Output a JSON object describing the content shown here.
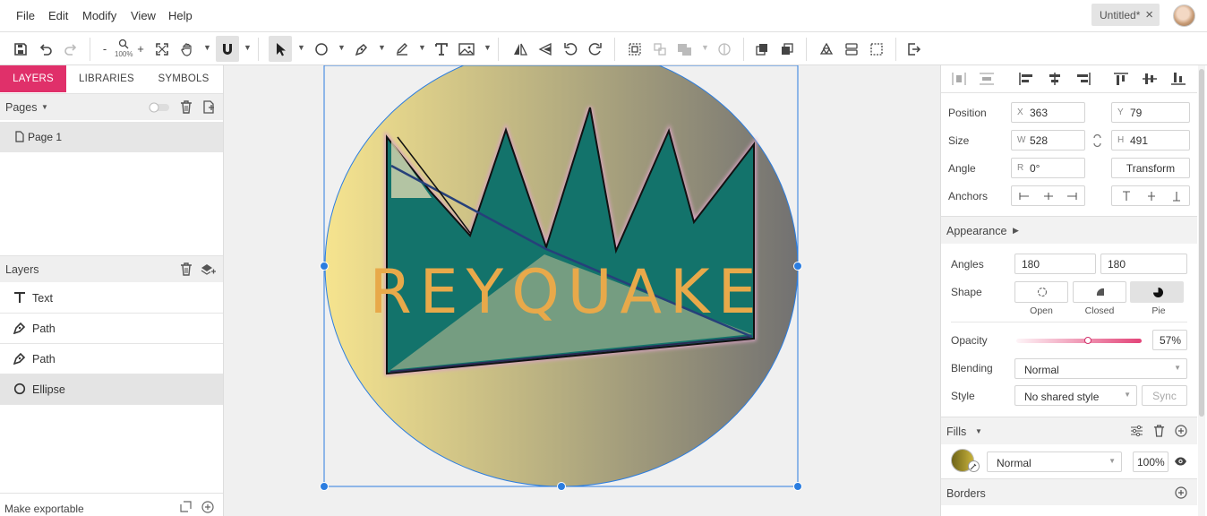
{
  "menu": {
    "file": "File",
    "edit": "Edit",
    "modify": "Modify",
    "view": "View",
    "help": "Help"
  },
  "document": {
    "title": "Untitled*"
  },
  "toolbar": {
    "zoom_level": "100%",
    "zoom_out": "-",
    "zoom_in": "+"
  },
  "left_panel": {
    "tabs": {
      "layers": "LAYERS",
      "libraries": "LIBRARIES",
      "symbols": "SYMBOLS"
    },
    "pages_header": "Pages",
    "pages": [
      {
        "name": "Page 1"
      }
    ],
    "layers_header": "Layers",
    "layers": [
      {
        "name": "Text",
        "icon": "text-icon"
      },
      {
        "name": "Path",
        "icon": "pen-icon"
      },
      {
        "name": "Path",
        "icon": "pen-icon"
      },
      {
        "name": "Ellipse",
        "icon": "ellipse-icon",
        "selected": true
      }
    ],
    "export_label": "Make exportable"
  },
  "canvas": {
    "logo_text": "REYQUAKE",
    "colors": {
      "teal": "#13736b",
      "gold": "#e8a94a",
      "gradient_start": "#f6e48f",
      "gradient_end": "#727171",
      "selection": "#2b7de0"
    }
  },
  "inspector": {
    "position": {
      "label": "Position",
      "x_prefix": "X",
      "x": "363",
      "y_prefix": "Y",
      "y": "79"
    },
    "size": {
      "label": "Size",
      "w_prefix": "W",
      "w": "528",
      "h_prefix": "H",
      "h": "491"
    },
    "angle": {
      "label": "Angle",
      "r_prefix": "R",
      "r": "0°",
      "transform_button": "Transform"
    },
    "anchors": {
      "label": "Anchors"
    },
    "appearance": {
      "header": "Appearance",
      "angles_label": "Angles",
      "angle_start": "180",
      "angle_end": "180",
      "shape_label": "Shape",
      "shape_options": {
        "open": "Open",
        "closed": "Closed",
        "pie": "Pie"
      },
      "shape_selected": "Pie",
      "opacity_label": "Opacity",
      "opacity_value": "57%",
      "opacity_fraction": 0.57,
      "blending_label": "Blending",
      "blending_value": "Normal",
      "style_label": "Style",
      "style_value": "No shared style",
      "sync_button": "Sync"
    },
    "fills": {
      "header": "Fills",
      "blend": "Normal",
      "opacity": "100%"
    },
    "borders": {
      "header": "Borders"
    },
    "accent_color": "#e0306a"
  }
}
